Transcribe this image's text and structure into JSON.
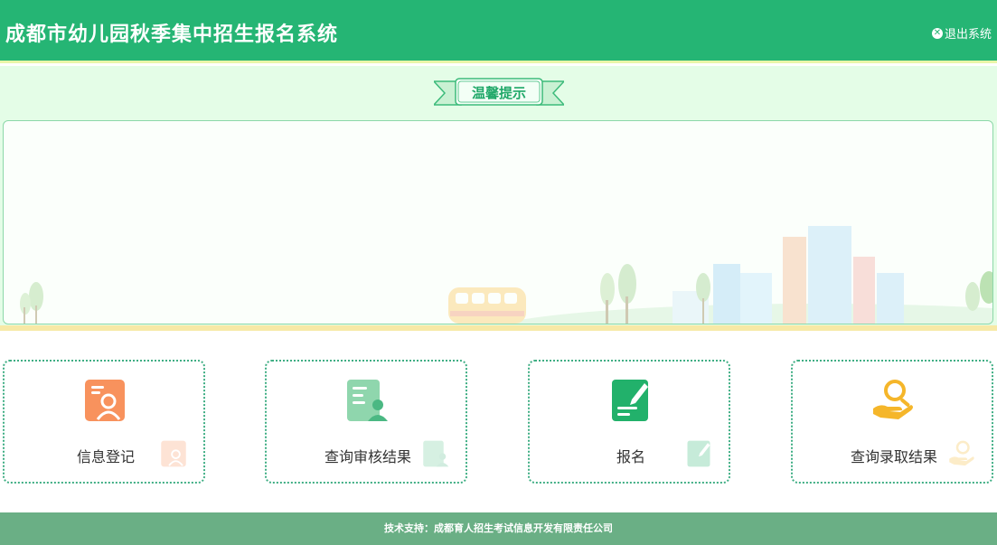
{
  "header": {
    "title": "成都市幼儿园秋季集中招生报名系统",
    "logout_label": "退出系统"
  },
  "notice": {
    "ribbon_label": "温馨提示"
  },
  "cards": [
    {
      "label": "信息登记",
      "icon": "profile-card-icon",
      "color": "#f8925d"
    },
    {
      "label": "查询审核结果",
      "icon": "audit-document-icon",
      "color": "#5fc48f"
    },
    {
      "label": "报名",
      "icon": "pen-document-icon",
      "color": "#22b16b"
    },
    {
      "label": "查询录取结果",
      "icon": "search-hand-icon",
      "color": "#f5b62a"
    }
  ],
  "footer": {
    "support_text": "技术支持：成都育人招生考试信息开发有限责任公司"
  },
  "colors": {
    "header_green": "#25b574",
    "notice_bg": "#e4fde7",
    "footer_green": "#6aaf85"
  }
}
